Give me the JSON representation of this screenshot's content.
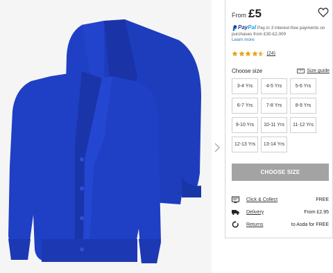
{
  "product": {
    "price_prefix": "From",
    "price": "£5"
  },
  "paypal": {
    "brand_pay": "Pay",
    "brand_pal": "Pal",
    "message": "Pay in 3 interest-free payments on purchases from £30-£2,000",
    "learn_more": "Learn more"
  },
  "rating": {
    "stars": 4.5,
    "max": 5,
    "count": "(24)"
  },
  "size_picker": {
    "title": "Choose size",
    "guide_label": "Size guide",
    "sizes": [
      "3-4 Yrs",
      "4-5 Yrs",
      "5-6 Yrs",
      "6-7 Yrs",
      "7-8 Yrs",
      "8-9 Yrs",
      "9-10 Yrs",
      "10-11 Yrs",
      "11-12 Yrs",
      "12-13 Yrs",
      "13-14 Yrs"
    ]
  },
  "cta": {
    "label": "CHOOSE SIZE"
  },
  "info_rows": [
    {
      "icon": "click-collect-icon",
      "label": "Click & Collect",
      "value": "FREE"
    },
    {
      "icon": "delivery-truck-icon",
      "label": "Delivery",
      "value": "From £2.95"
    },
    {
      "icon": "returns-icon",
      "label": "Returns",
      "value": "to Asda for FREE"
    }
  ],
  "colors": {
    "cardigan_blue": "#1f3fc4",
    "star_gold": "#e8a317",
    "button_grey": "#a3a3a3",
    "paypal_navy": "#1a3a8c",
    "paypal_cyan": "#1ea0e0"
  }
}
